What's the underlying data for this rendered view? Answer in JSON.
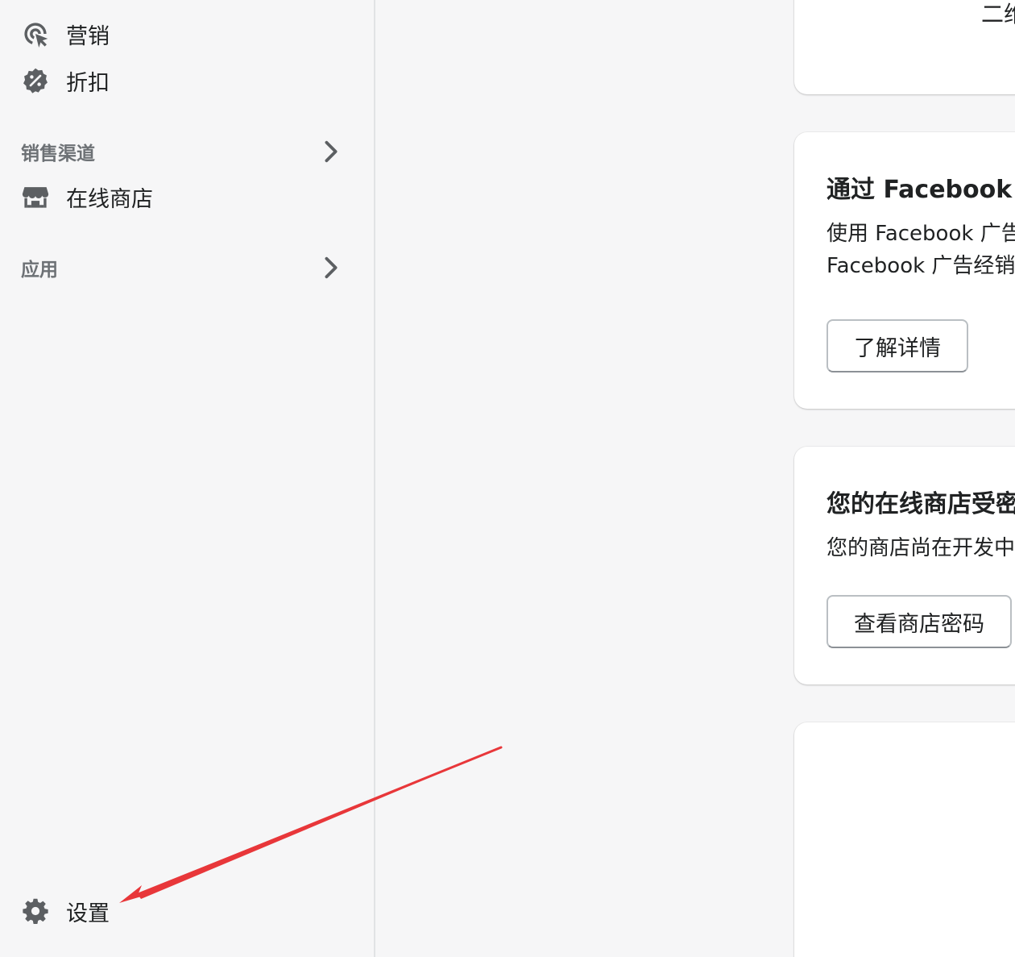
{
  "sidebar": {
    "items": [
      {
        "label": "营销",
        "icon": "marketing-target-icon"
      },
      {
        "label": "折扣",
        "icon": "discount-badge-icon"
      }
    ],
    "sales_channels": {
      "title": "销售渠道",
      "items": [
        {
          "label": "在线商店",
          "icon": "store-icon"
        }
      ]
    },
    "apps": {
      "title": "应用"
    },
    "settings": {
      "label": "设置",
      "icon": "gear-icon"
    }
  },
  "cards": [
    {
      "partial_text": "二维"
    },
    {
      "heading": "通过 Facebook M",
      "body_line1": "使用 Facebook 广告",
      "body_line2": "Facebook 广告经销",
      "button": "了解详情"
    },
    {
      "heading": "您的在线商店受密",
      "body_line1": "您的商店尚在开发中",
      "button": "查看商店密码"
    }
  ],
  "colors": {
    "annotation_arrow": "#e8373a",
    "sidebar_bg": "#f6f6f7",
    "icon": "#5c5f62",
    "section_title": "#6d7175"
  }
}
